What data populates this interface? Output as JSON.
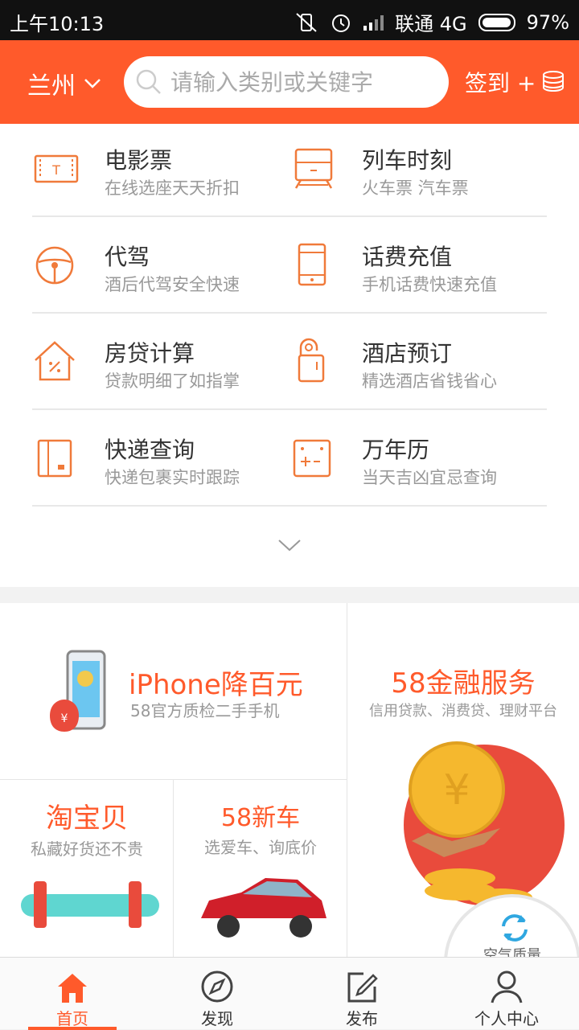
{
  "status_bar": {
    "time": "上午10:13",
    "carrier": "联通 4G",
    "battery_percent": "97%",
    "battery_level": 0.97
  },
  "header": {
    "city": "兰州",
    "search_placeholder": "请输入类别或关键字",
    "signin_label": "签到 +"
  },
  "services": [
    {
      "title": "电影票",
      "subtitle": "在线选座天天折扣",
      "icon": "ticket-icon"
    },
    {
      "title": "列车时刻",
      "subtitle": "火车票 汽车票",
      "icon": "train-icon"
    },
    {
      "title": "代驾",
      "subtitle": "酒后代驾安全快速",
      "icon": "steering-wheel-icon"
    },
    {
      "title": "话费充值",
      "subtitle": "手机话费快速充值",
      "icon": "phone-icon"
    },
    {
      "title": "房贷计算",
      "subtitle": "贷款明细了如指掌",
      "icon": "house-percent-icon"
    },
    {
      "title": "酒店预订",
      "subtitle": "精选酒店省钱省心",
      "icon": "door-hanger-icon"
    },
    {
      "title": "快递查询",
      "subtitle": "快递包裹实时跟踪",
      "icon": "package-icon"
    },
    {
      "title": "万年历",
      "subtitle": "当天吉凶宜忌查询",
      "icon": "calendar-icon"
    }
  ],
  "promos": {
    "iphone": {
      "title": "iPhone降百元",
      "subtitle": "58官方质检二手手机"
    },
    "finance": {
      "title": "58金融服务",
      "subtitle": "信用贷款、消费贷、理财平台"
    },
    "taobao": {
      "title": "淘宝贝",
      "subtitle": "私藏好货还不贵"
    },
    "newcar": {
      "title": "58新车",
      "subtitle": "选爱车、询底价"
    }
  },
  "air_quality": {
    "label": "空气质量"
  },
  "tabs": [
    {
      "label": "首页",
      "icon": "home-icon",
      "active": true
    },
    {
      "label": "发现",
      "icon": "compass-icon",
      "active": false
    },
    {
      "label": "发布",
      "icon": "edit-icon",
      "active": false
    },
    {
      "label": "个人中心",
      "icon": "user-icon",
      "active": false
    }
  ],
  "colors": {
    "accent": "#ff5a2b",
    "icon": "#f07a3a"
  }
}
